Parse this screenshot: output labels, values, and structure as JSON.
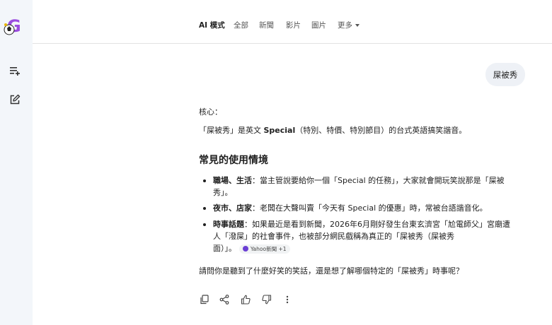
{
  "nav": {
    "tabs": [
      "AI 模式",
      "全部",
      "新聞",
      "影片",
      "圖片",
      "更多"
    ]
  },
  "user_message": "屎被秀",
  "answer": {
    "intro_label": "核心：",
    "intro": "「屎被秀」是英文 Special（特別、特價、特別節目）的台式英語搞笑諧音。",
    "section_title": "常見的使用情境",
    "bullets": [
      {
        "term": "職場、生活",
        "line1": "：當主管說要給你一個「Special 的任務」，大家就會開玩笑說那是「屎被",
        "line2": "秀」。"
      },
      {
        "term": "夜市、店家",
        "line1": "：老闆在大聲叫賣「今天有 Special 的優惠」時，常被台語諧音化。",
        "line2": ""
      },
      {
        "term": "時事話題",
        "line1": "：如果最近是看到新聞，2026年6月剛好發生台東玄濟宮「尬電師父」宮廟遭",
        "line2": "人「潑屎」的社會事件，也被部分網民戲稱為真正的「屎被秀（屎被秀",
        "line3": "面）」。"
      }
    ],
    "source_chip": "Yahoo新聞 +1",
    "closing": "請問你是聽到了什麼好笑的笑話，還是想了解哪個特定的「屎被秀」時事呢？"
  },
  "icons": {
    "logo": "google-g-logo",
    "rail": [
      "playlist-add-icon",
      "edit-square-icon"
    ],
    "actions": [
      "copy-icon",
      "share-icon",
      "thumb-up-icon",
      "thumb-down-icon",
      "more-vert-icon"
    ]
  },
  "colors": {
    "rail_bg": "#f3f6fa",
    "bubble_bg": "#eef1f6",
    "logo_purple": "#9b4de0"
  }
}
